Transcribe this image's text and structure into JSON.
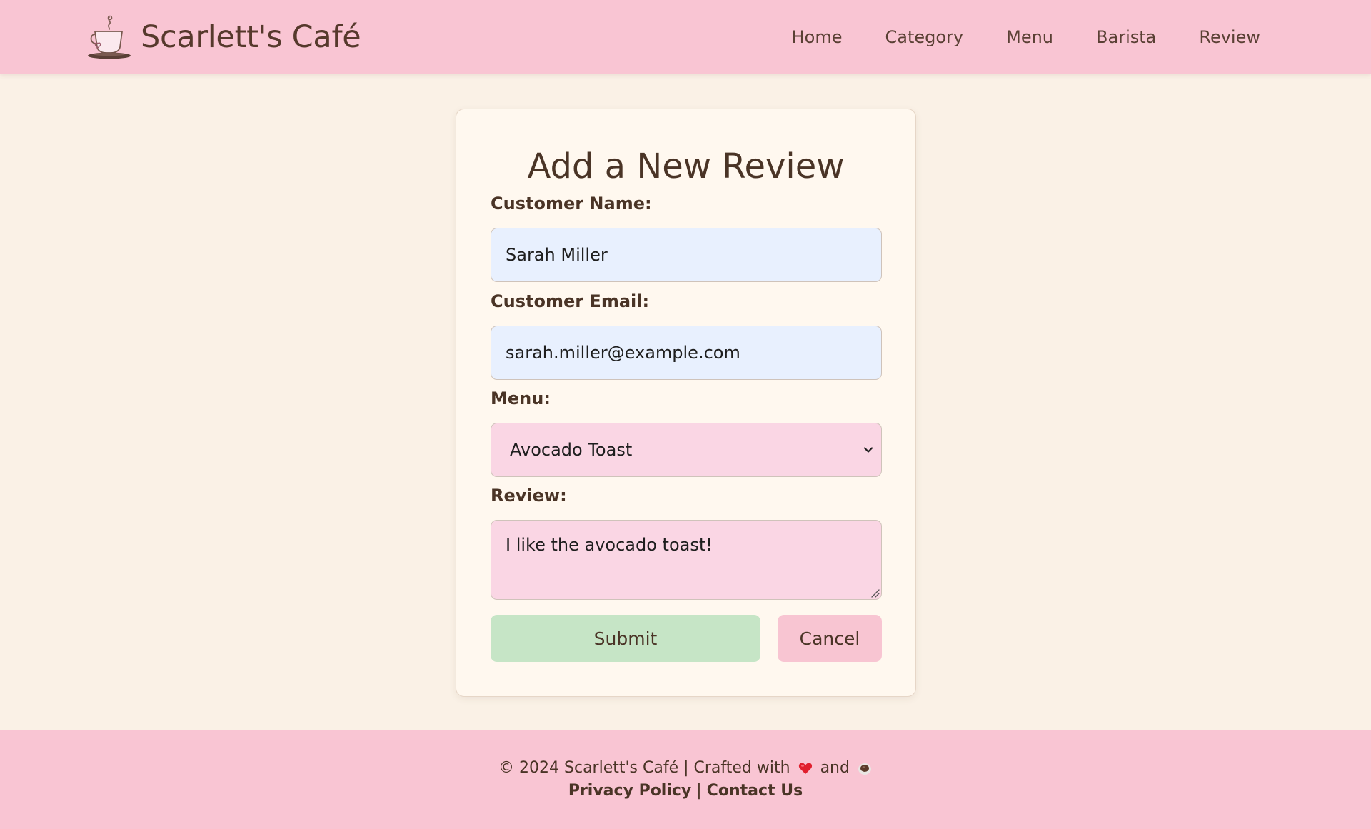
{
  "brand": {
    "name": "Scarlett's Café",
    "icon": "coffee-cup-icon"
  },
  "nav": {
    "items": [
      "Home",
      "Category",
      "Menu",
      "Barista",
      "Review"
    ]
  },
  "form": {
    "title": "Add a New Review",
    "customer_name": {
      "label": "Customer Name:",
      "value": "Sarah Miller"
    },
    "customer_email": {
      "label": "Customer Email:",
      "value": "sarah.miller@example.com"
    },
    "menu": {
      "label": "Menu:",
      "selected": "Avocado Toast"
    },
    "review": {
      "label": "Review:",
      "value": "I like the avocado toast!"
    },
    "submit_label": "Submit",
    "cancel_label": "Cancel"
  },
  "footer": {
    "copyright": "© 2024 Scarlett's Café | Crafted with",
    "and_text": "and",
    "links": {
      "privacy": "Privacy Policy",
      "separator": "|",
      "contact": "Contact Us"
    }
  },
  "colors": {
    "header_bg": "#f9c5d3",
    "page_bg": "#faf1e6",
    "card_bg": "#fff8ef",
    "input_bg": "#e8f0fe",
    "select_bg": "#fad6e4",
    "submit_bg": "#c6e5c6",
    "cancel_bg": "#f8c5d2",
    "text": "#4a3426"
  }
}
